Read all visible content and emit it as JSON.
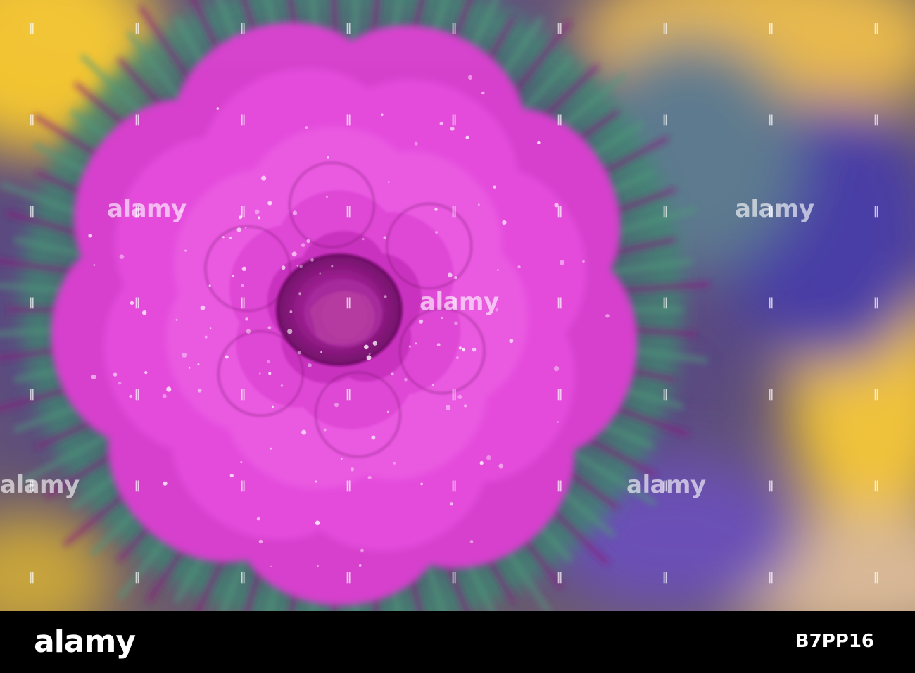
{
  "photo": {
    "subject_icon": "ornamental-cabbage-photo",
    "colors": {
      "magenta": "#e43fd8",
      "deep_purple": "#8a1a7e",
      "leaf_green": "#3f8a70",
      "yellow": "#f2c430",
      "violet": "#6a4fb6"
    }
  },
  "watermark": {
    "text": "alamy"
  },
  "footer": {
    "logo_text": "alamy",
    "image_id": "B7PP16"
  }
}
